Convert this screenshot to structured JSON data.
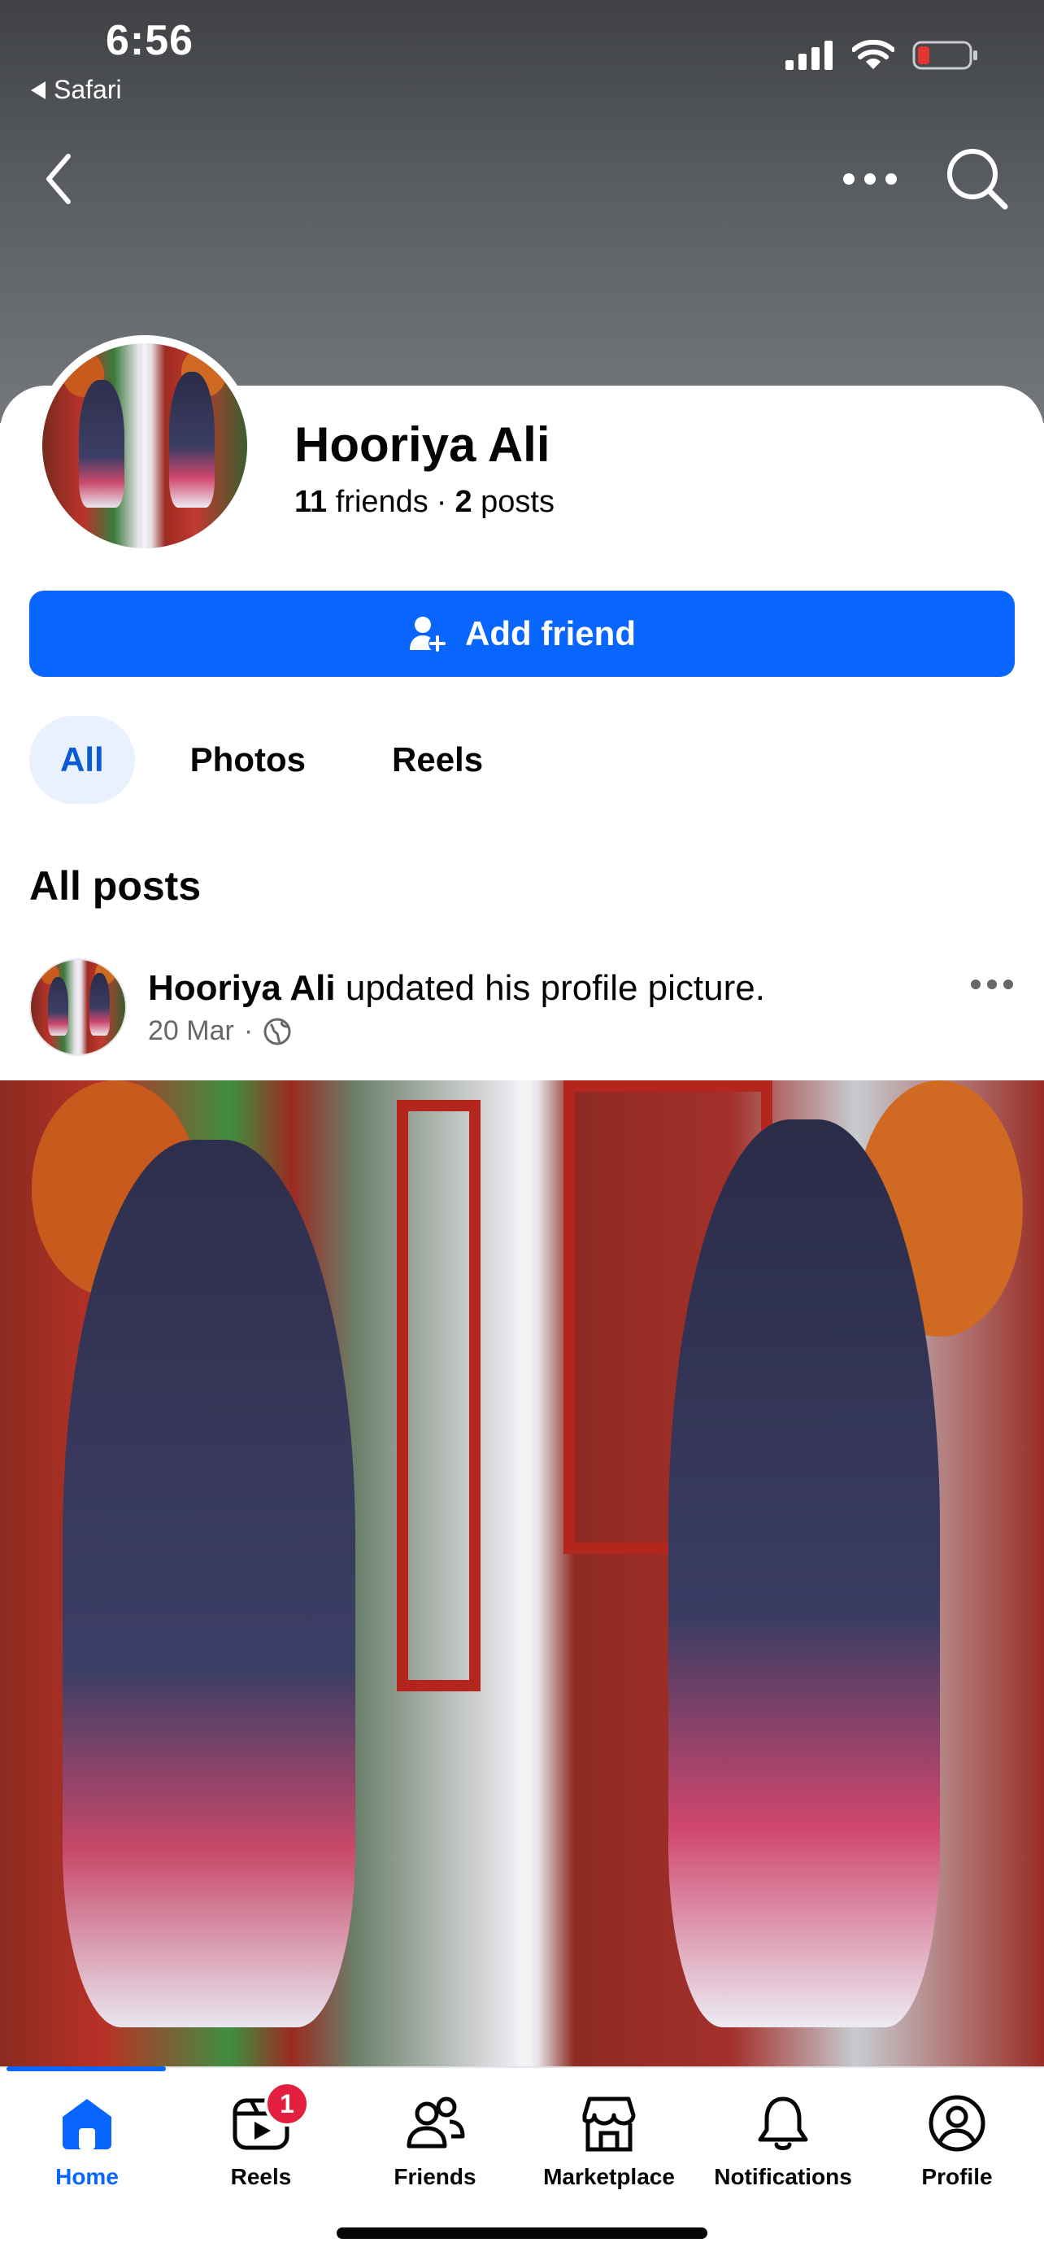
{
  "status_bar": {
    "time": "6:56",
    "back_app": "Safari",
    "battery_color": "#e3342f"
  },
  "top_nav": {
    "back_icon": "chevron-left-icon",
    "more_icon": "more-horizontal-icon",
    "search_icon": "search-icon"
  },
  "profile": {
    "name": "Hooriya Ali",
    "friends_count": "11",
    "friends_label": "friends",
    "separator": "·",
    "posts_count": "2",
    "posts_label": "posts"
  },
  "actions": {
    "add_friend_label": "Add friend",
    "add_friend_color": "#0866ff"
  },
  "filter_tabs": [
    {
      "label": "All",
      "active": true
    },
    {
      "label": "Photos",
      "active": false
    },
    {
      "label": "Reels",
      "active": false
    }
  ],
  "section": {
    "title": "All posts"
  },
  "post": {
    "author": "Hooriya Ali",
    "action_text": " updated his profile picture.",
    "date": "20 Mar",
    "dot": "·",
    "privacy_icon": "globe-icon"
  },
  "bottom_nav": [
    {
      "label": "Home",
      "icon": "home-icon",
      "active": true
    },
    {
      "label": "Reels",
      "icon": "reels-icon",
      "active": false,
      "badge": "1"
    },
    {
      "label": "Friends",
      "icon": "friends-icon",
      "active": false
    },
    {
      "label": "Marketplace",
      "icon": "marketplace-icon",
      "active": false
    },
    {
      "label": "Notifications",
      "icon": "bell-icon",
      "active": false
    },
    {
      "label": "Profile",
      "icon": "profile-icon",
      "active": false
    }
  ]
}
